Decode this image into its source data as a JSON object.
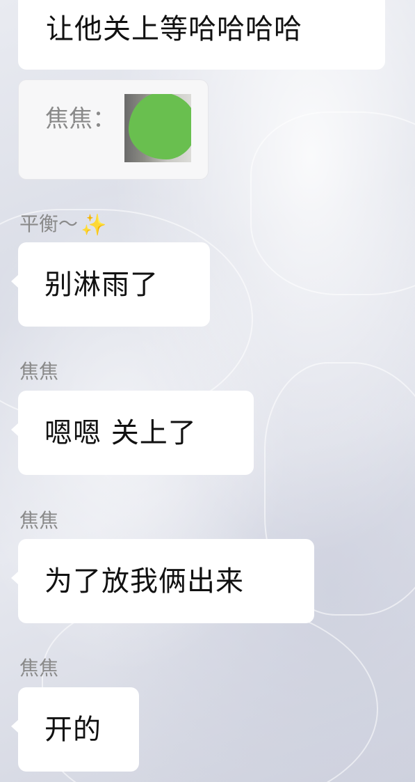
{
  "messages": [
    {
      "text": "让他关上等哈哈哈哈"
    },
    {
      "quote": {
        "label": "焦焦："
      }
    },
    {
      "sender": "平衡～",
      "sender_icon": "sparkles-icon",
      "text": "别淋雨了"
    },
    {
      "sender": "焦焦",
      "text": "嗯嗯 关上了"
    },
    {
      "sender": "焦焦",
      "text": "为了放我俩出来"
    },
    {
      "sender": "焦焦",
      "text": "开的"
    }
  ],
  "colors": {
    "bubble": "#ffffff",
    "sender_name": "#8a8a8a",
    "redaction": "#69bf4f",
    "sparkle": "#f2c94c"
  }
}
